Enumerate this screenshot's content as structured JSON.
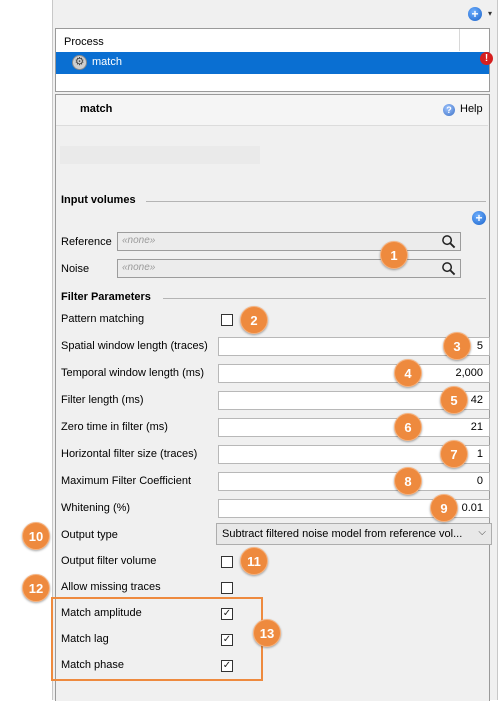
{
  "toolbar": {
    "add_icon": "plus-circle-icon",
    "menu_caret": "▾"
  },
  "process_list": {
    "header": "Process",
    "selected_item": {
      "label": "match",
      "icon": "gear-icon",
      "status_icon": "error-icon",
      "status_glyph": "!"
    }
  },
  "panel": {
    "title": "match",
    "help_label": "Help"
  },
  "input_volumes": {
    "heading": "Input volumes",
    "fields": [
      {
        "label": "Reference",
        "placeholder": "«none»"
      },
      {
        "label": "Noise",
        "placeholder": "«none»"
      }
    ]
  },
  "filter_parameters": {
    "heading": "Filter Parameters",
    "pattern_matching": {
      "label": "Pattern matching",
      "checked": false
    },
    "numeric_fields": [
      {
        "label": "Spatial window length (traces)",
        "value": "5"
      },
      {
        "label": "Temporal window length (ms)",
        "value": "2,000"
      },
      {
        "label": "Filter length (ms)",
        "value": "42"
      },
      {
        "label": "Zero time in filter (ms)",
        "value": "21"
      },
      {
        "label": "Horizontal filter size (traces)",
        "value": "1"
      },
      {
        "label": "Maximum Filter Coefficient",
        "value": "0"
      },
      {
        "label": "Whitening (%)",
        "value": "0.01"
      }
    ],
    "output_type": {
      "label": "Output type",
      "value": "Subtract filtered noise model from reference vol..."
    },
    "checkboxes": [
      {
        "label": "Output filter volume",
        "checked": false
      },
      {
        "label": "Allow missing traces",
        "checked": false
      },
      {
        "label": "Match amplitude",
        "checked": true
      },
      {
        "label": "Match lag",
        "checked": true
      },
      {
        "label": "Match phase",
        "checked": true
      }
    ]
  },
  "callouts": [
    "1",
    "2",
    "3",
    "4",
    "5",
    "6",
    "7",
    "8",
    "9",
    "10",
    "11",
    "12",
    "13"
  ],
  "colors": {
    "selection": "#0a6fd2",
    "callout": "#ee8a3e",
    "error": "#d61f1f"
  }
}
